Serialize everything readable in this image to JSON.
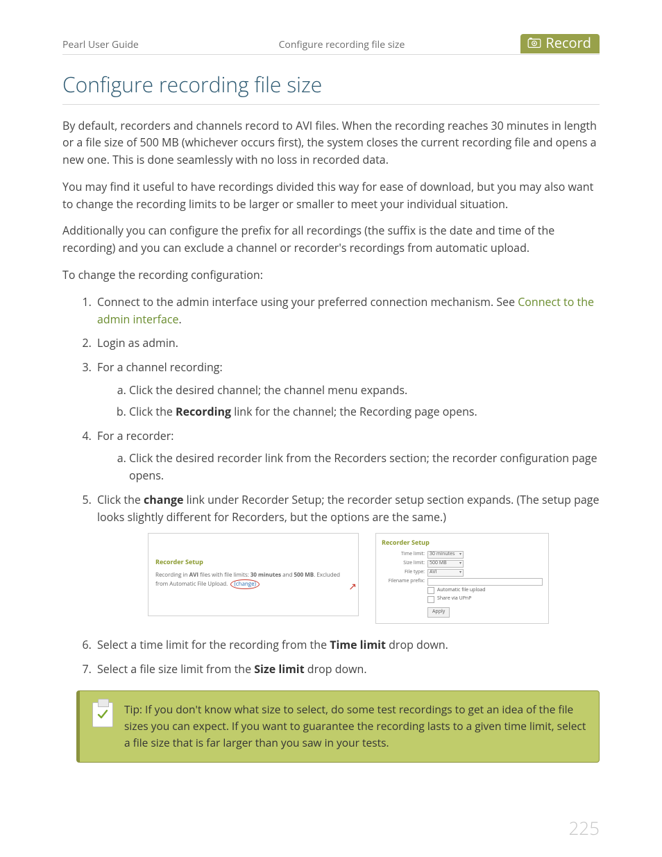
{
  "header": {
    "left": "Pearl User Guide",
    "center": "Configure recording file size",
    "tab_label": "Record"
  },
  "title": "Configure recording file size",
  "paragraphs": {
    "p1": "By default, recorders and channels record to AVI files. When the recording reaches 30 minutes in length or a file size of 500 MB (whichever occurs first), the system closes the current recording file and opens a new one. This is done seamlessly with no loss in recorded data.",
    "p2": "You may find it useful to have recordings divided this way for ease of download, but you may also want to change the recording limits to be larger or smaller to meet your individual situation.",
    "p3": "Additionally you can configure the prefix for all recordings (the suffix is the date and time of the recording) and you can exclude a channel or recorder's recordings from automatic upload.",
    "p4": "To change the recording configuration:"
  },
  "steps": {
    "s1_pre": "Connect to the admin interface using your preferred connection mechanism. See ",
    "s1_link": "Connect to the admin interface",
    "s1_post": ".",
    "s2": "Login as admin.",
    "s3": "For a channel recording:",
    "s3a": "Click the desired channel; the channel menu expands.",
    "s3b_pre": "Click the ",
    "s3b_bold": "Recording",
    "s3b_post": " link for the channel; the Recording page opens.",
    "s4": "For a recorder:",
    "s4a": "Click the desired recorder link from the Recorders section; the recorder configuration page opens.",
    "s5_pre": "Click the ",
    "s5_bold": "change",
    "s5_post": " link under Recorder Setup; the recorder setup section expands. (The setup page looks slightly different for Recorders, but the options are the same.)",
    "s6_pre": "Select a time limit for the recording from the ",
    "s6_bold": "Time limit",
    "s6_post": " drop down.",
    "s7_pre": "Select a file size limit from the ",
    "s7_bold": "Size limit",
    "s7_post": " drop down."
  },
  "screenshot_left": {
    "heading": "Recorder Setup",
    "line_pre": "Recording in ",
    "line_b1": "AVI",
    "line_mid1": " files with file limits: ",
    "line_b2": "30 minutes",
    "line_mid2": " and ",
    "line_b3": "500 MB",
    "line_mid3": ". Excluded from Automatic File Upload. ",
    "change": "(change)"
  },
  "screenshot_right": {
    "heading": "Recorder Setup",
    "fields": {
      "time_label": "Time limit:",
      "time_value": "30 minutes",
      "size_label": "Size limit:",
      "size_value": "500 MB",
      "type_label": "File type:",
      "type_value": "AVI",
      "prefix_label": "Filename prefix:",
      "chk1": "Automatic file upload",
      "chk2": "Share via UPnP",
      "apply": "Apply"
    }
  },
  "tip": "Tip: If you don't know what size to select, do some test recordings to get an idea of the file sizes you can expect. If you want to guarantee the recording lasts to a given time limit, select a file size that is far larger than you saw in your tests.",
  "page_number": "225"
}
